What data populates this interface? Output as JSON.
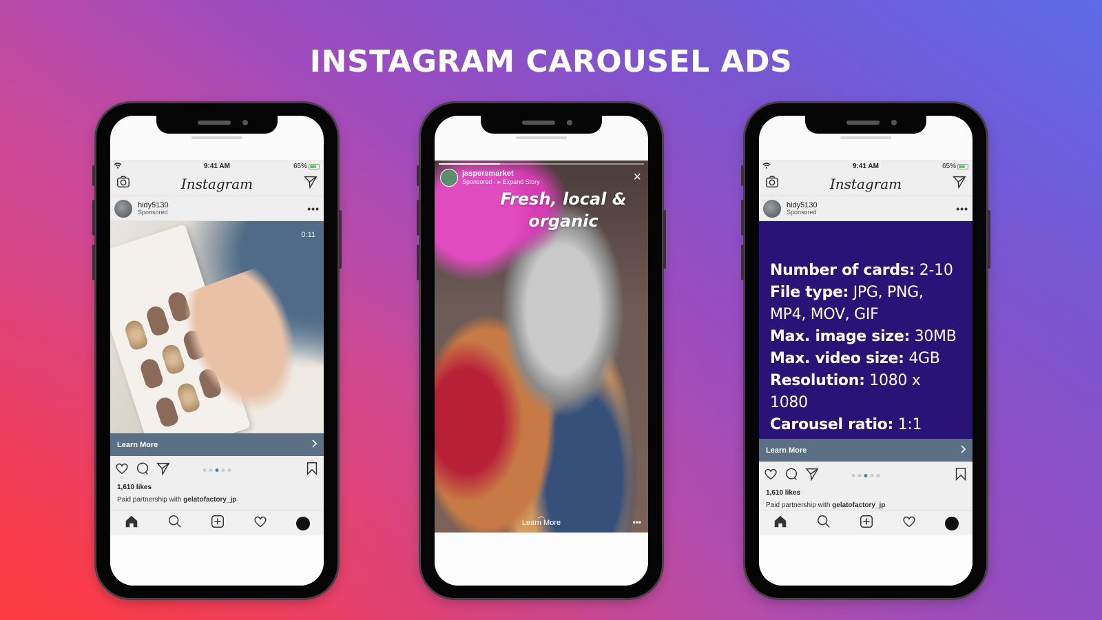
{
  "page": {
    "headline": "INSTAGRAM CAROUSEL ADS",
    "colors": {
      "gradient_bottom_left": "#fd3a45",
      "gradient_top_left": "#d04590",
      "gradient_top_right": "#5d6ae6",
      "gradient_bottom_right": "#8a55c8",
      "cta_bar": "#5b6f85",
      "info_card": "#2a1376",
      "active_dot": "#3b88c3"
    }
  },
  "phones": [
    {
      "status": {
        "time": "9:41 AM",
        "battery": "65%",
        "wifi_icon": "wifi-icon"
      },
      "nav": {
        "logo": "Instagram",
        "left_icon": "camera-icon",
        "right_icon": "direct-send-icon"
      },
      "post": {
        "username": "hidy5130",
        "sponsored": "Sponsored",
        "more": "•••",
        "media_desc": "Nail sticker product card held in hand",
        "duration": "0:11",
        "cta": "Learn More",
        "cta_icon": "chevron-right-icon",
        "carousel_dots": 5,
        "active_dot": 3,
        "likes": "1,610 likes",
        "caption_prefix": "Paid partnership with ",
        "caption_partner": "gelatofactory_jp"
      },
      "bottom_nav": [
        "home-icon",
        "search-icon",
        "add-post-icon",
        "activity-heart-icon",
        "profile-icon"
      ]
    },
    {
      "story": {
        "username": "jaspersmarket",
        "sponsored": "Sponsored",
        "expand": "▸ Expand Story",
        "separator": " · ",
        "close": "×",
        "headline_line1": "Fresh, local &",
        "headline_line2": "organic",
        "media_desc": "Pink petunias, colander of raspberries, bowls of raspberries and blueberries",
        "cta_chevron": "︿",
        "cta": "Learn More",
        "more": "•••",
        "progress": 0.3
      }
    },
    {
      "status": {
        "time": "9:41 AM",
        "battery": "65%",
        "wifi_icon": "wifi-icon"
      },
      "nav": {
        "logo": "Instagram",
        "left_icon": "camera-icon",
        "right_icon": "direct-send-icon"
      },
      "post": {
        "username": "hidy5130",
        "sponsored": "Sponsored",
        "more": "•••",
        "specs": [
          {
            "key": "Number of cards:",
            "value": " 2-10"
          },
          {
            "key": "File type:",
            "value": " JPG, PNG, MP4, MOV, GIF"
          },
          {
            "key": "Max. image size:",
            "value": " 30MB"
          },
          {
            "key": "Max. video size:",
            "value": " 4GB"
          },
          {
            "key": "Resolution:",
            "value": " 1080 x 1080"
          },
          {
            "key": "Carousel ratio:",
            "value": " 1:1"
          }
        ],
        "cta": "Learn More",
        "cta_icon": "chevron-right-icon",
        "carousel_dots": 5,
        "active_dot": 3,
        "likes": "1,610 likes",
        "caption_prefix": "Paid partnership with ",
        "caption_partner": "gelatofactory_jp"
      },
      "bottom_nav": [
        "home-icon",
        "search-icon",
        "add-post-icon",
        "activity-heart-icon",
        "profile-icon"
      ]
    }
  ]
}
